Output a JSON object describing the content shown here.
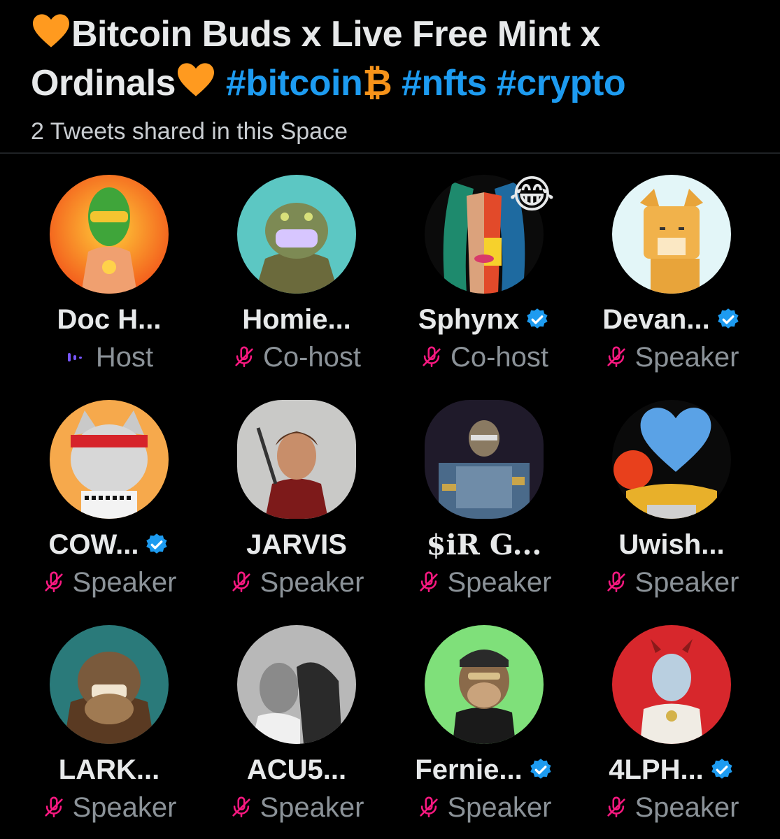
{
  "space": {
    "title_part1": "Bitcoin Buds x Live Free Mint x",
    "title_part2": "Ordinals",
    "hashtag_bitcoin": "#bitcoin",
    "bitcoin_symbol": "₿",
    "hashtag_nfts": "#nfts",
    "hashtag_crypto": "#crypto",
    "subtitle": "2 Tweets shared in this Space"
  },
  "colors": {
    "accent_blue": "#1d9bf0",
    "muted_pink": "#f91880",
    "host_purple": "#7856ff",
    "heart_orange": "#ff9a1f",
    "bitcoin_orange": "#f7931a"
  },
  "participants": [
    {
      "name": "Doc H...",
      "role": "Host",
      "verified": false,
      "role_icon": "audio-wave-icon"
    },
    {
      "name": "Homie...",
      "role": "Co-host",
      "verified": false,
      "role_icon": "mic-off-icon"
    },
    {
      "name": "Sphynx",
      "role": "Co-host",
      "verified": true,
      "role_icon": "mic-off-icon",
      "reaction": "😂"
    },
    {
      "name": "Devan...",
      "role": "Speaker",
      "verified": true,
      "role_icon": "mic-off-icon"
    },
    {
      "name": "COW...",
      "role": "Speaker",
      "verified": true,
      "role_icon": "mic-off-icon"
    },
    {
      "name": "JARVIS",
      "role": "Speaker",
      "verified": false,
      "role_icon": "mic-off-icon"
    },
    {
      "name": "$iR G...",
      "role": "Speaker",
      "verified": false,
      "role_icon": "mic-off-icon"
    },
    {
      "name": "Uwish...",
      "role": "Speaker",
      "verified": false,
      "role_icon": "mic-off-icon",
      "reaction": "blue-heart"
    },
    {
      "name": "LARK...",
      "role": "Speaker",
      "verified": false,
      "role_icon": "mic-off-icon"
    },
    {
      "name": "ACU5...",
      "role": "Speaker",
      "verified": false,
      "role_icon": "mic-off-icon"
    },
    {
      "name": "Fernie...",
      "role": "Speaker",
      "verified": true,
      "role_icon": "mic-off-icon"
    },
    {
      "name": "4LPH...",
      "role": "Speaker",
      "verified": true,
      "role_icon": "mic-off-icon"
    }
  ]
}
